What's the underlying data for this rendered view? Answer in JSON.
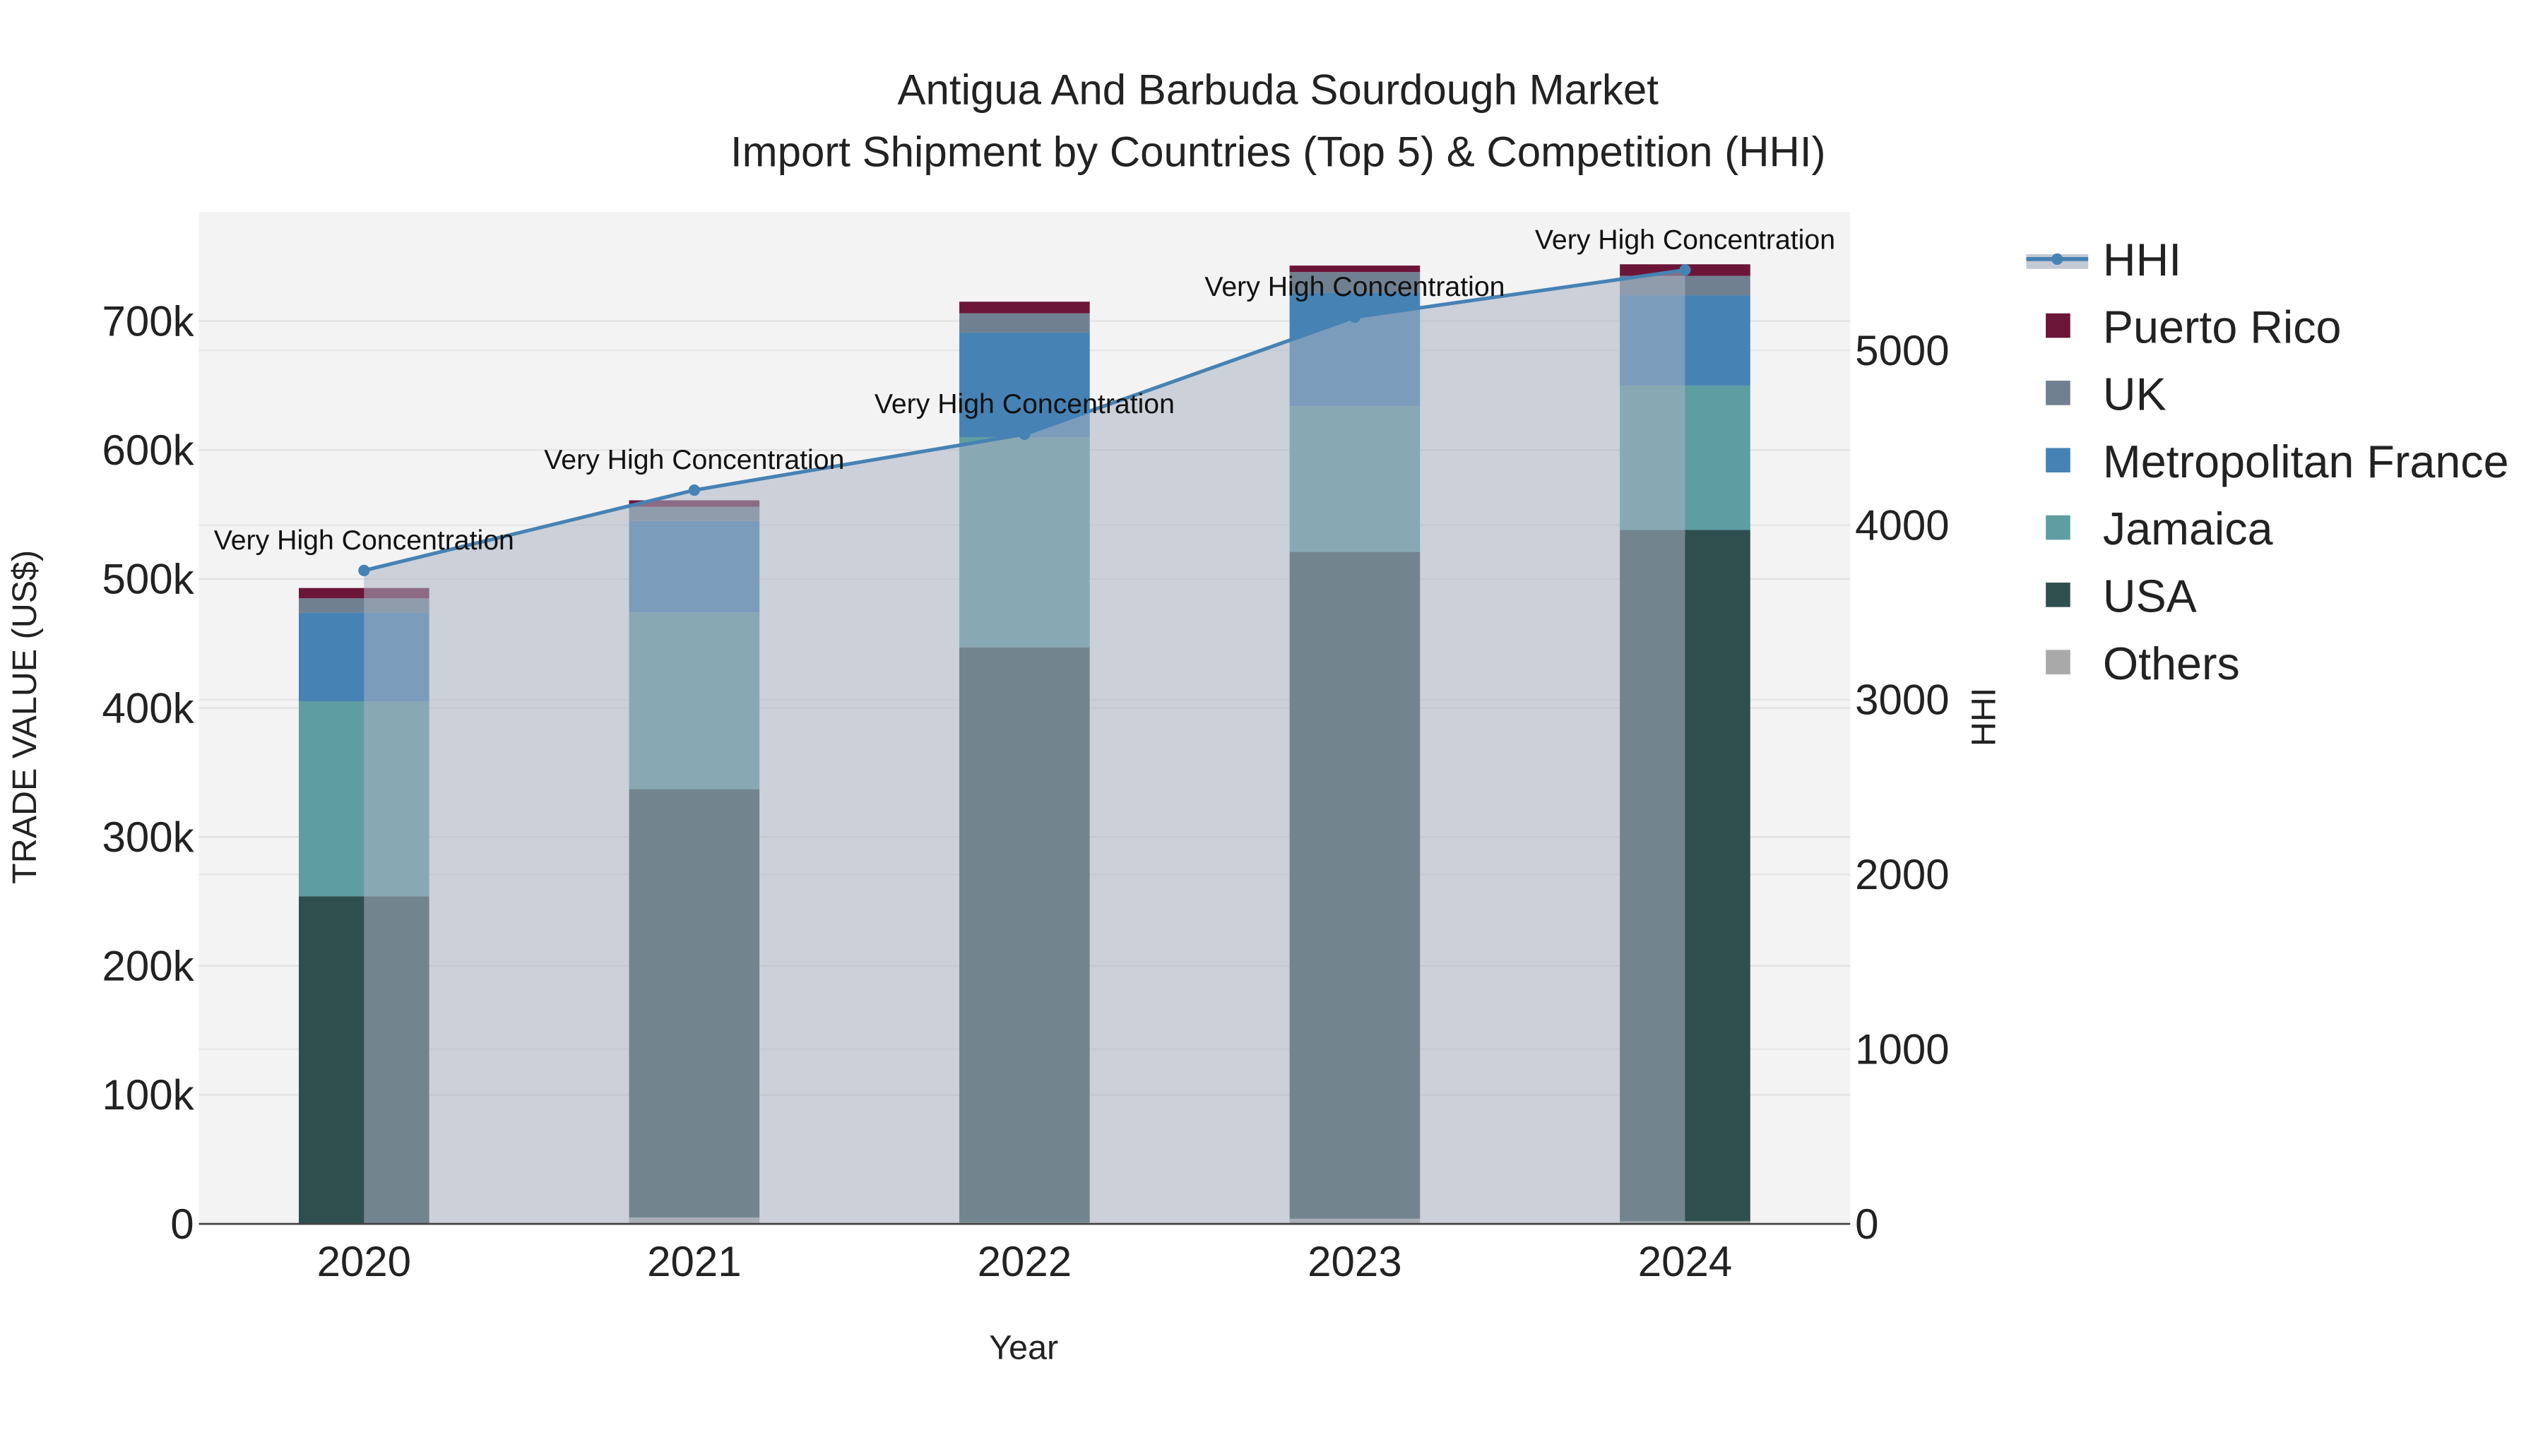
{
  "chart_data": {
    "type": "bar",
    "title": "Antigua And Barbuda Sourdough Market",
    "subtitle": "Import Shipment by Countries (Top 5) & Competition (HHI)",
    "xlabel": "Year",
    "ylabel": "TRADE VALUE (US$)",
    "y2label": "HHI",
    "categories": [
      "2020",
      "2021",
      "2022",
      "2023",
      "2024"
    ],
    "stacked": true,
    "ylim": [
      0,
      780000
    ],
    "y2lim": [
      0,
      5800
    ],
    "yticks": [
      0,
      100000,
      200000,
      300000,
      400000,
      500000,
      600000,
      700000
    ],
    "ytick_labels": [
      "0",
      "100k",
      "200k",
      "300k",
      "400k",
      "500k",
      "600k",
      "700k"
    ],
    "y2ticks": [
      0,
      1000,
      2000,
      3000,
      4000,
      5000
    ],
    "y2tick_labels": [
      "0",
      "1000",
      "2000",
      "3000",
      "4000",
      "5000"
    ],
    "series": [
      {
        "name": "Others",
        "color": "#a9a9a9",
        "values": [
          0,
          5000,
          1000,
          4000,
          2000
        ]
      },
      {
        "name": "USA",
        "color": "#2f4f4f",
        "values": [
          254000,
          332000,
          446000,
          517000,
          536000
        ]
      },
      {
        "name": "Jamaica",
        "color": "#5f9ea0",
        "values": [
          151000,
          137000,
          163000,
          113000,
          112000
        ]
      },
      {
        "name": "Metropolitan France",
        "color": "#4682b4",
        "values": [
          69000,
          71000,
          81000,
          88000,
          70000
        ]
      },
      {
        "name": "UK",
        "color": "#708090",
        "values": [
          11000,
          11000,
          15000,
          16000,
          15000
        ]
      },
      {
        "name": "Puerto Rico",
        "color": "#6b1538",
        "values": [
          8000,
          5000,
          9000,
          5000,
          9000
        ]
      }
    ],
    "line": {
      "name": "HHI",
      "color": "#4682b4",
      "axis": "right",
      "values": [
        3740,
        4200,
        4520,
        5190,
        5460
      ]
    },
    "annotations": [
      "Very High Concentration",
      "Very High Concentration",
      "Very High Concentration",
      "Very High Concentration",
      "Very High Concentration"
    ],
    "legend_order": [
      "HHI",
      "Puerto Rico",
      "UK",
      "Metropolitan France",
      "Jamaica",
      "USA",
      "Others"
    ],
    "legend_placement": "right",
    "grid": true
  }
}
